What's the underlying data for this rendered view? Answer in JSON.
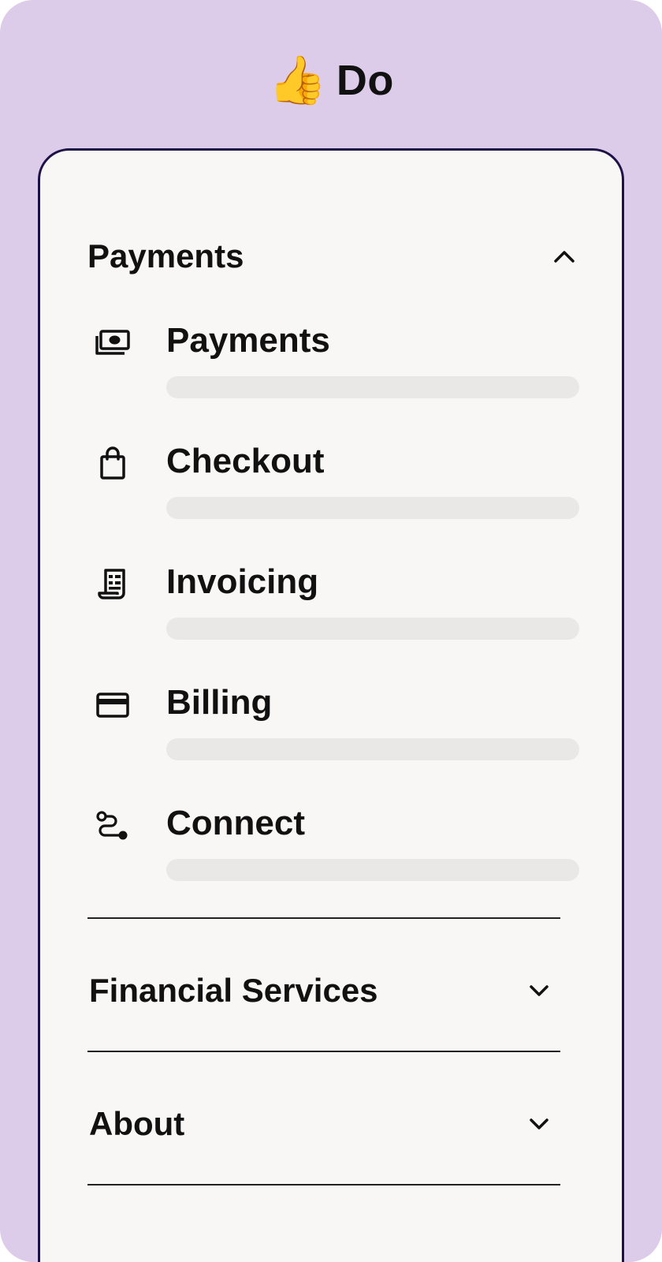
{
  "header": {
    "emoji": "👍",
    "title": "Do"
  },
  "menu": {
    "payments_section": {
      "title": "Payments",
      "state": "expanded",
      "items": [
        {
          "label": "Payments",
          "icon": "cash-icon"
        },
        {
          "label": "Checkout",
          "icon": "shopping-bag-icon"
        },
        {
          "label": "Invoicing",
          "icon": "receipt-icon"
        },
        {
          "label": "Billing",
          "icon": "credit-card-icon"
        },
        {
          "label": "Connect",
          "icon": "connect-route-icon"
        }
      ]
    },
    "financial_section": {
      "title": "Financial Services",
      "state": "collapsed"
    },
    "about_section": {
      "title": "About",
      "state": "collapsed"
    }
  },
  "colors": {
    "background": "#dccbe9",
    "card": "#f8f7f6",
    "card_border": "#1e1146",
    "skeleton": "#e9e8e6",
    "text": "#111111"
  }
}
